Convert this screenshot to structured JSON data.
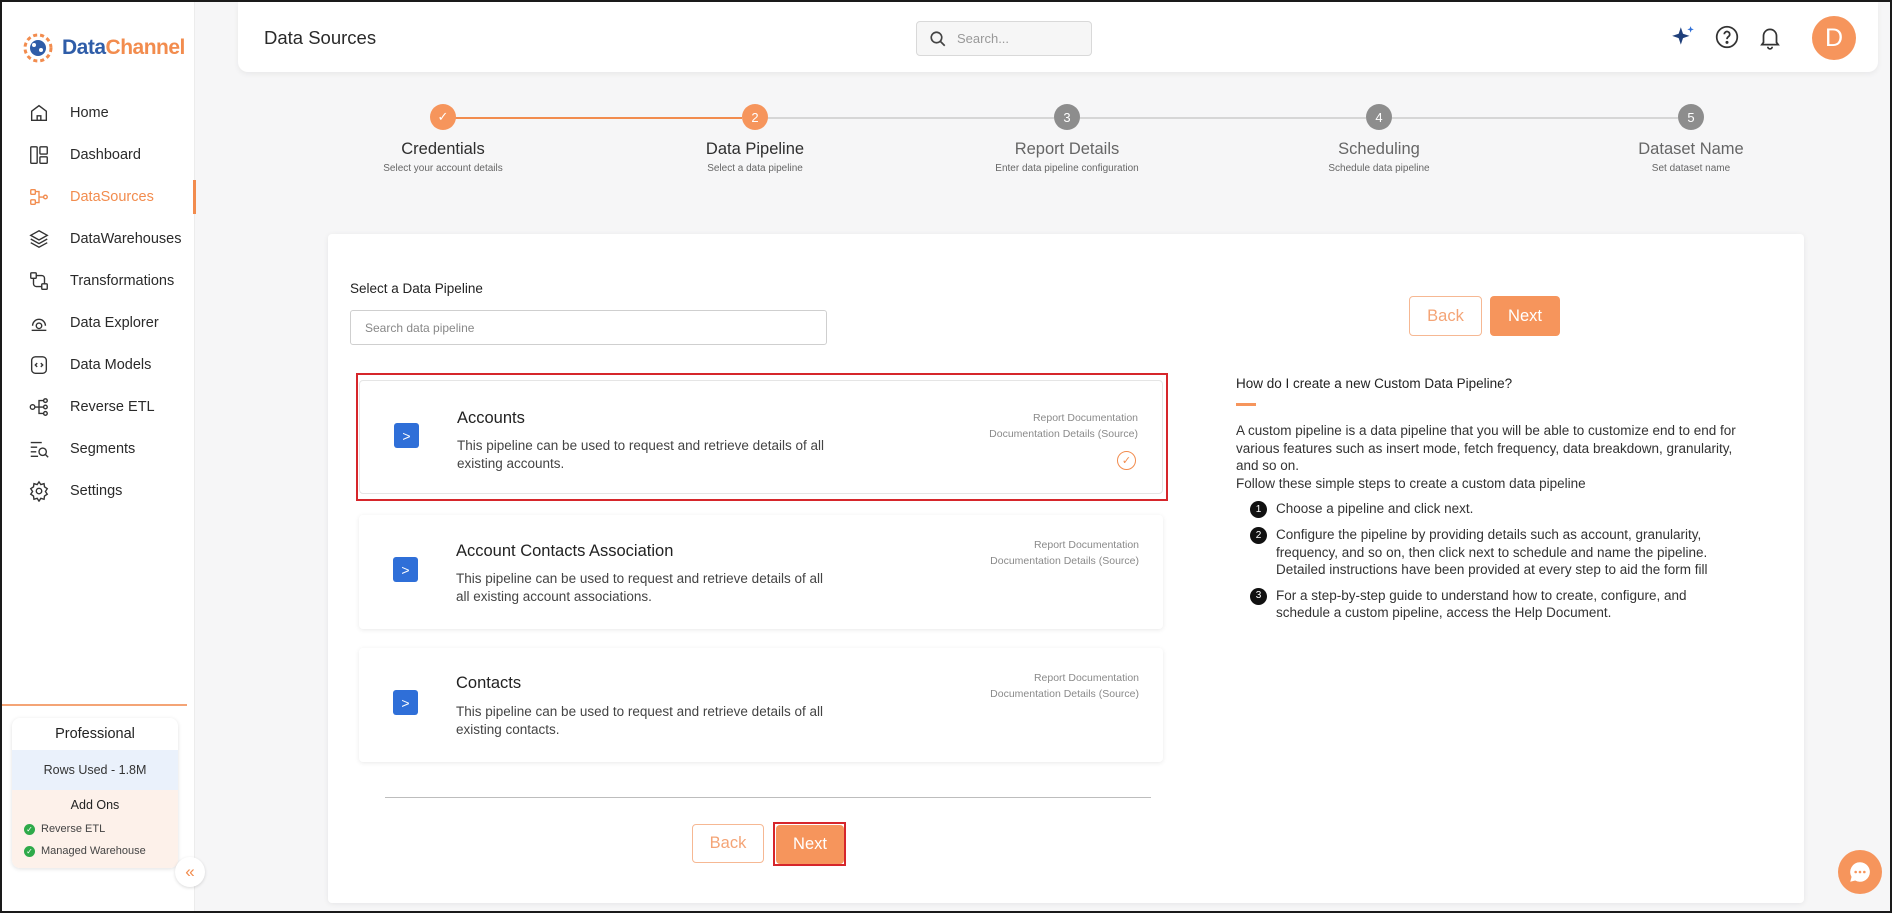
{
  "app": {
    "brand_part1": "Data",
    "brand_part2": "Channel"
  },
  "sidebar": {
    "items": [
      {
        "label": "Home",
        "icon": "home-icon"
      },
      {
        "label": "Dashboard",
        "icon": "dashboard-icon"
      },
      {
        "label": "DataSources",
        "icon": "datasources-icon",
        "active": true
      },
      {
        "label": "DataWarehouses",
        "icon": "layers-icon"
      },
      {
        "label": "Transformations",
        "icon": "transform-icon"
      },
      {
        "label": "Data Explorer",
        "icon": "explorer-icon"
      },
      {
        "label": "Data Models",
        "icon": "models-icon"
      },
      {
        "label": "Reverse ETL",
        "icon": "reverse-etl-icon"
      },
      {
        "label": "Segments",
        "icon": "segments-icon"
      },
      {
        "label": "Settings",
        "icon": "gear-icon"
      }
    ],
    "plan": {
      "title": "Professional",
      "rows_used": "Rows Used - 1.8M",
      "addons_title": "Add Ons",
      "addons": [
        "Reverse ETL",
        "Managed Warehouse"
      ]
    }
  },
  "header": {
    "title": "Data Sources",
    "search_placeholder": "Search...",
    "avatar_initial": "D"
  },
  "stepper": {
    "current_step": 2,
    "steps": [
      {
        "number": "1",
        "label": "Credentials",
        "sub": "Select your account details",
        "status": "complete"
      },
      {
        "number": "2",
        "label": "Data Pipeline",
        "sub": "Select a data pipeline",
        "status": "active"
      },
      {
        "number": "3",
        "label": "Report Details",
        "sub": "Enter data pipeline configuration",
        "status": "pending"
      },
      {
        "number": "4",
        "label": "Scheduling",
        "sub": "Schedule data pipeline",
        "status": "pending"
      },
      {
        "number": "5",
        "label": "Dataset Name",
        "sub": "Set dataset name",
        "status": "pending"
      }
    ]
  },
  "main": {
    "select_label": "Select a Data Pipeline",
    "search_placeholder": "Search data pipeline",
    "pipelines": [
      {
        "name": "Accounts",
        "description": "This pipeline can be used to request and retrieve details of all existing accounts.",
        "link1": "Report Documentation",
        "link2": "Documentation Details (Source)",
        "selected": true
      },
      {
        "name": "Account Contacts Association",
        "description": "This pipeline can be used to request and retrieve details of all all existing account associations.",
        "link1": "Report Documentation",
        "link2": "Documentation Details (Source)",
        "selected": false
      },
      {
        "name": "Contacts",
        "description": "This pipeline can be used to request and retrieve details of all existing contacts.",
        "link1": "Report Documentation",
        "link2": "Documentation Details (Source)",
        "selected": false
      }
    ],
    "back_label": "Back",
    "next_label": "Next"
  },
  "help": {
    "title": "How do I create a new Custom Data Pipeline?",
    "intro": "A custom pipeline is a data pipeline that you will be able to customize end to end for various features such as insert mode, fetch frequency, data breakdown, granularity, and so on.",
    "intro2": "Follow these simple steps to create a custom data pipeline",
    "steps": [
      {
        "n": "1",
        "text": "Choose a pipeline and click next."
      },
      {
        "n": "2",
        "text": "Configure the pipeline by providing details such as account, granularity, frequency, and so on, then click next to schedule and name the pipeline. Detailed instructions have been provided at every step to aid the form fill"
      },
      {
        "n": "3",
        "text": "For a step-by-step guide to understand how to create, configure, and schedule a custom pipeline, access the Help Document."
      }
    ]
  },
  "colors": {
    "accent": "#f6955c",
    "pipeline_icon": "#2f6fd8",
    "highlight": "#d6262b",
    "success": "#2eaa4a"
  }
}
